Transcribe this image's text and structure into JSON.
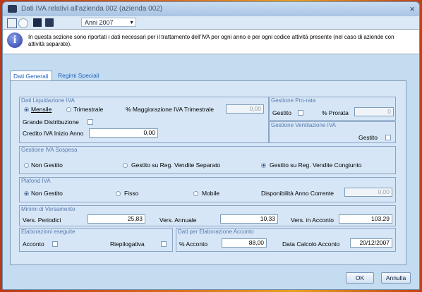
{
  "window": {
    "title": "Dati IVA relativi all'azienda 002 (azienda 002)",
    "close": "×"
  },
  "toolbar": {
    "year": "Anni 2007"
  },
  "info": {
    "text": "In questa sezione sono riportati i dati necessari per il trattamento dell'IVA per ogni anno e per ogni codice attività presente (nel caso di aziende con attività separate)."
  },
  "tabs": [
    "Dati Generali",
    "Regimi Speciali"
  ],
  "liquidazione": {
    "title": "Dati Liquidazione IVA",
    "mensile": "Mensile",
    "trimestrale": "Trimestrale",
    "maggiorazione_label": "% Maggiorazione IVA Trimestrale",
    "maggiorazione_value": "0,00",
    "grande_distribuzione": "Grande Distribuzione",
    "credito_label": "Credito IVA Inizio Anno",
    "credito_value": "0,00"
  },
  "prorata": {
    "title": "Gestione Pro-rata",
    "gestito": "Gestito",
    "perc_label": "% Prorata",
    "perc_value": "0"
  },
  "ventilazione": {
    "title": "Gestione Ventilazione IVA",
    "gestito": "Gestito"
  },
  "sospesa": {
    "title": "Gestione IVA Sospesa",
    "opt1": "Non Gestito",
    "opt2": "Gestito su Reg. Vendite Separato",
    "opt3": "Gestito su Reg. Vendite Congiunto"
  },
  "plafond": {
    "title": "Plafond IVA",
    "opt1": "Non Gestito",
    "opt2": "Fisso",
    "opt3": "Mobile",
    "disp_label": "Disponibilità Anno Corrente",
    "disp_value": "0,00"
  },
  "versamenti": {
    "title": "Minimi di Versamento",
    "periodici_label": "Vers. Periodici",
    "periodici_value": "25,83",
    "annuale_label": "Vers. Annuale",
    "annuale_value": "10,33",
    "acconto_label": "Vers. in Acconto",
    "acconto_value": "103,29"
  },
  "elaborazioni": {
    "title": "Elaborazioni eseguite",
    "acconto": "Acconto",
    "riepilogativa": "Riepilogativa"
  },
  "acconto": {
    "title": "Dati per Elaborazione Acconto",
    "perc_label": "% Acconto",
    "perc_value": "88,00",
    "data_label": "Data Calcolo Acconto",
    "data_value": "20/12/2007"
  },
  "buttons": {
    "ok": "OK",
    "annulla": "Annulla"
  }
}
